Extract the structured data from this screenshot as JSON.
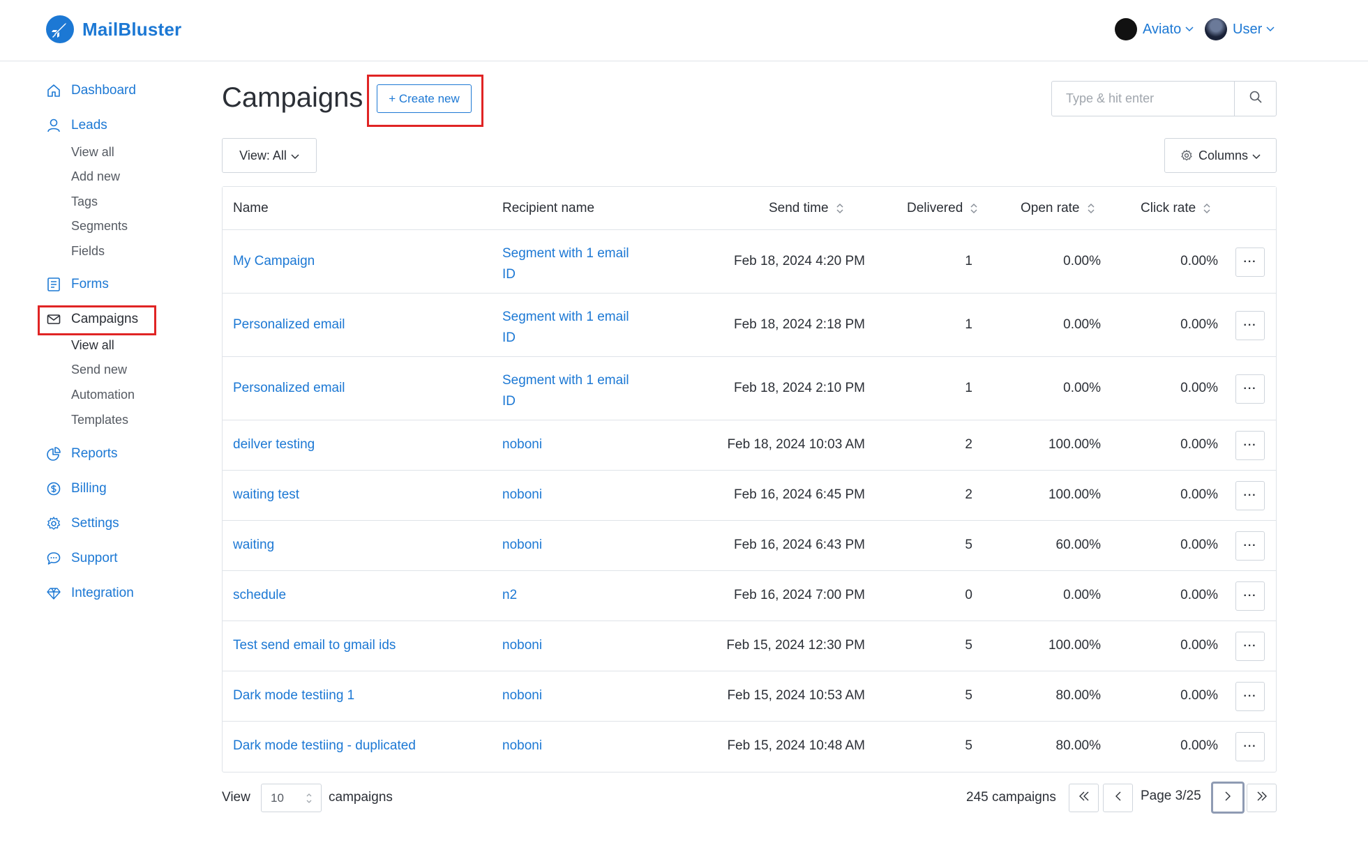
{
  "header": {
    "brand": "MailBluster",
    "accounts": [
      {
        "label": "Aviato"
      },
      {
        "label": "User"
      }
    ]
  },
  "sidebar": {
    "items": [
      {
        "label": "Dashboard",
        "icon": "home-icon"
      },
      {
        "label": "Leads",
        "icon": "user-icon",
        "children": [
          "View all",
          "Add new",
          "Tags",
          "Segments",
          "Fields"
        ]
      },
      {
        "label": "Forms",
        "icon": "form-icon"
      },
      {
        "label": "Campaigns",
        "icon": "envelope-icon",
        "active": true,
        "children": [
          "View all",
          "Send new",
          "Automation",
          "Templates"
        ]
      },
      {
        "label": "Reports",
        "icon": "pie-chart-icon"
      },
      {
        "label": "Billing",
        "icon": "dollar-icon"
      },
      {
        "label": "Settings",
        "icon": "gear-icon"
      },
      {
        "label": "Support",
        "icon": "chat-icon"
      },
      {
        "label": "Integration",
        "icon": "diamond-icon"
      }
    ]
  },
  "main": {
    "title": "Campaigns",
    "create_button": "+ Create new",
    "search_placeholder": "Type & hit enter",
    "view_filter": "View: All",
    "columns_button": "Columns",
    "table": {
      "headers": {
        "name": "Name",
        "recipient": "Recipient name",
        "send_time": "Send time",
        "delivered": "Delivered",
        "open_rate": "Open rate",
        "click_rate": "Click rate"
      },
      "rows": [
        {
          "name": "My Campaign",
          "recipient_line1": "Segment with 1 email",
          "recipient_line2": "ID",
          "send_time": "Feb 18, 2024 4:20 PM",
          "delivered": "1",
          "open_rate": "0.00%",
          "click_rate": "0.00%",
          "more": "···"
        },
        {
          "name": "Personalized email",
          "recipient_line1": "Segment with 1 email",
          "recipient_line2": "ID",
          "send_time": "Feb 18, 2024 2:18 PM",
          "delivered": "1",
          "open_rate": "0.00%",
          "click_rate": "0.00%",
          "more": "···"
        },
        {
          "name": "Personalized email",
          "recipient_line1": "Segment with 1 email",
          "recipient_line2": "ID",
          "send_time": "Feb 18, 2024 2:10 PM",
          "delivered": "1",
          "open_rate": "0.00%",
          "click_rate": "0.00%",
          "more": "···"
        },
        {
          "name": "deilver testing",
          "recipient_line1": "noboni",
          "recipient_line2": "",
          "send_time": "Feb 18, 2024 10:03 AM",
          "delivered": "2",
          "open_rate": "100.00%",
          "click_rate": "0.00%",
          "more": "···"
        },
        {
          "name": "waiting test",
          "recipient_line1": "noboni",
          "recipient_line2": "",
          "send_time": "Feb 16, 2024 6:45 PM",
          "delivered": "2",
          "open_rate": "100.00%",
          "click_rate": "0.00%",
          "more": "···"
        },
        {
          "name": "waiting",
          "recipient_line1": "noboni",
          "recipient_line2": "",
          "send_time": "Feb 16, 2024 6:43 PM",
          "delivered": "5",
          "open_rate": "60.00%",
          "click_rate": "0.00%",
          "more": "···"
        },
        {
          "name": "schedule",
          "recipient_line1": "n2",
          "recipient_line2": "",
          "send_time": "Feb 16, 2024 7:00 PM",
          "delivered": "0",
          "open_rate": "0.00%",
          "click_rate": "0.00%",
          "more": "···"
        },
        {
          "name": "Test send email to gmail ids",
          "recipient_line1": "noboni",
          "recipient_line2": "",
          "send_time": "Feb 15, 2024 12:30 PM",
          "delivered": "5",
          "open_rate": "100.00%",
          "click_rate": "0.00%",
          "more": "···"
        },
        {
          "name": "Dark mode testiing 1",
          "recipient_line1": "noboni",
          "recipient_line2": "",
          "send_time": "Feb 15, 2024 10:53 AM",
          "delivered": "5",
          "open_rate": "80.00%",
          "click_rate": "0.00%",
          "more": "···"
        },
        {
          "name": "Dark mode testiing - duplicated",
          "recipient_line1": "noboni",
          "recipient_line2": "",
          "send_time": "Feb 15, 2024 10:48 AM",
          "delivered": "5",
          "open_rate": "80.00%",
          "click_rate": "0.00%",
          "more": "···"
        }
      ]
    },
    "footer": {
      "view_label": "View",
      "per_page": "10",
      "campaigns_label": "campaigns",
      "total": "245 campaigns",
      "page_label": "Page 3/25"
    }
  },
  "colors": {
    "accent": "#1c78d4",
    "highlight": "#e02424",
    "border": "#dfe3e8"
  }
}
